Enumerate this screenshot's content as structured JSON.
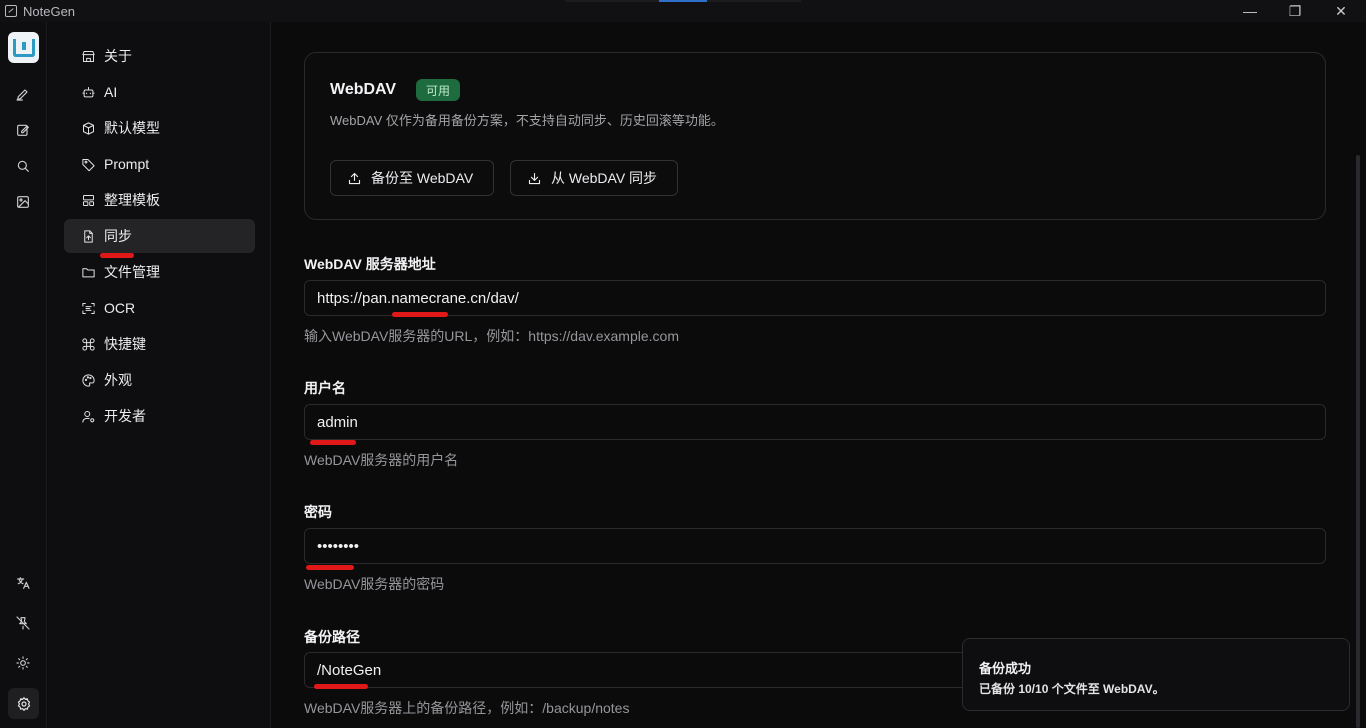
{
  "window": {
    "title": "NoteGen",
    "minimize_glyph": "—",
    "maximize_glyph": "❐",
    "close_glyph": "✕"
  },
  "rail": {
    "items": [
      "pen-icon",
      "edit-icon",
      "search-icon",
      "image-icon"
    ],
    "bottom_items": [
      "translate-icon",
      "pin-off-icon",
      "sun-icon",
      "settings-icon"
    ]
  },
  "nav": {
    "items": [
      {
        "label": "关于",
        "icon": "store-icon"
      },
      {
        "label": "AI",
        "icon": "bot-icon"
      },
      {
        "label": "默认模型",
        "icon": "box-icon"
      },
      {
        "label": "Prompt",
        "icon": "tag-icon"
      },
      {
        "label": "整理模板",
        "icon": "layout-icon"
      },
      {
        "label": "同步",
        "icon": "file-sync-icon",
        "active": true
      },
      {
        "label": "文件管理",
        "icon": "folder-icon"
      },
      {
        "label": "OCR",
        "icon": "scan-text-icon"
      },
      {
        "label": "快捷键",
        "icon": "command-icon"
      },
      {
        "label": "外观",
        "icon": "palette-icon"
      },
      {
        "label": "开发者",
        "icon": "user-cog-icon"
      }
    ]
  },
  "webdav_card": {
    "title": "WebDAV",
    "badge": "可用",
    "description": "WebDAV 仅作为备用备份方案，不支持自动同步、历史回滚等功能。",
    "backup_button": "备份至 WebDAV",
    "sync_button": "从 WebDAV 同步"
  },
  "form": {
    "server": {
      "label": "WebDAV 服务器地址",
      "value": "https://pan.namecrane.cn/dav/",
      "help": "输入WebDAV服务器的URL，例如：https://dav.example.com"
    },
    "username": {
      "label": "用户名",
      "value": "admin",
      "help": "WebDAV服务器的用户名"
    },
    "password": {
      "label": "密码",
      "value": "••••••••",
      "help": "WebDAV服务器的密码"
    },
    "path": {
      "label": "备份路径",
      "value": "/NoteGen",
      "help": "WebDAV服务器上的备份路径，例如：/backup/notes"
    }
  },
  "toast": {
    "title": "备份成功",
    "description": "已备份 10/10 个文件至 WebDAV。"
  },
  "colors": {
    "background": "#0b0b0c",
    "badge_bg": "#1d6b3e",
    "annotation": "#e01818",
    "accent": "#2f6fc9"
  }
}
